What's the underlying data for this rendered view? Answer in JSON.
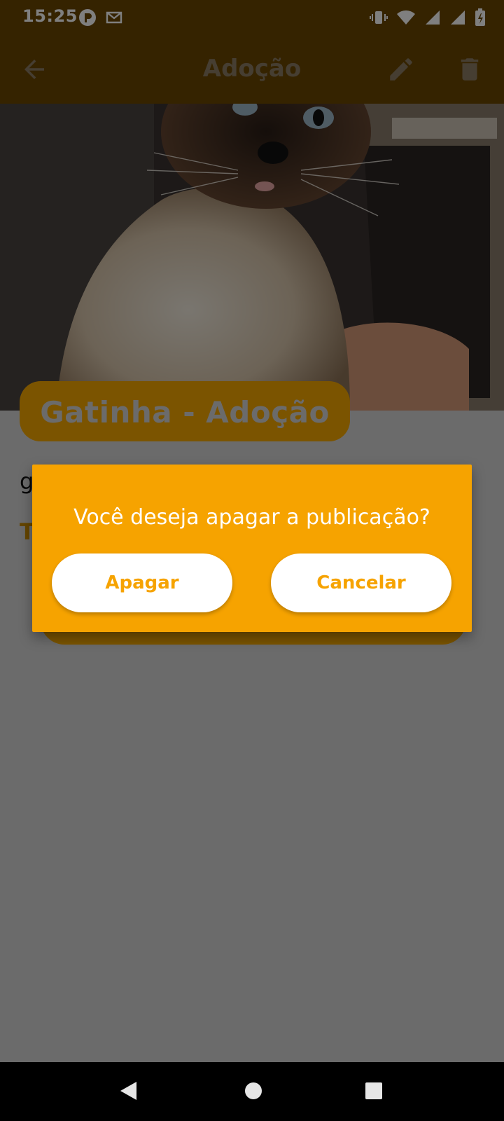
{
  "status_bar": {
    "time": "15:25",
    "left_icons": [
      "p-app-icon",
      "gmail-icon"
    ],
    "right_icons": [
      "vibrate-icon",
      "wifi-icon",
      "signal-icon",
      "signal-icon",
      "battery-icon"
    ]
  },
  "app_bar": {
    "title": "Adoção",
    "back_icon": "arrow-back-icon",
    "edit_icon": "pencil-icon",
    "delete_icon": "trash-icon"
  },
  "post": {
    "title": "Gatinha - Adoção",
    "description": "g",
    "meta": "T"
  },
  "dialog": {
    "message": "Você deseja apagar a publicação?",
    "delete_label": "Apagar",
    "cancel_label": "Cancelar"
  },
  "colors": {
    "primary": "#f6a300",
    "primary_dark": "#6a4700",
    "dialog_text": "#ffffff",
    "button_text": "#f6a300"
  }
}
